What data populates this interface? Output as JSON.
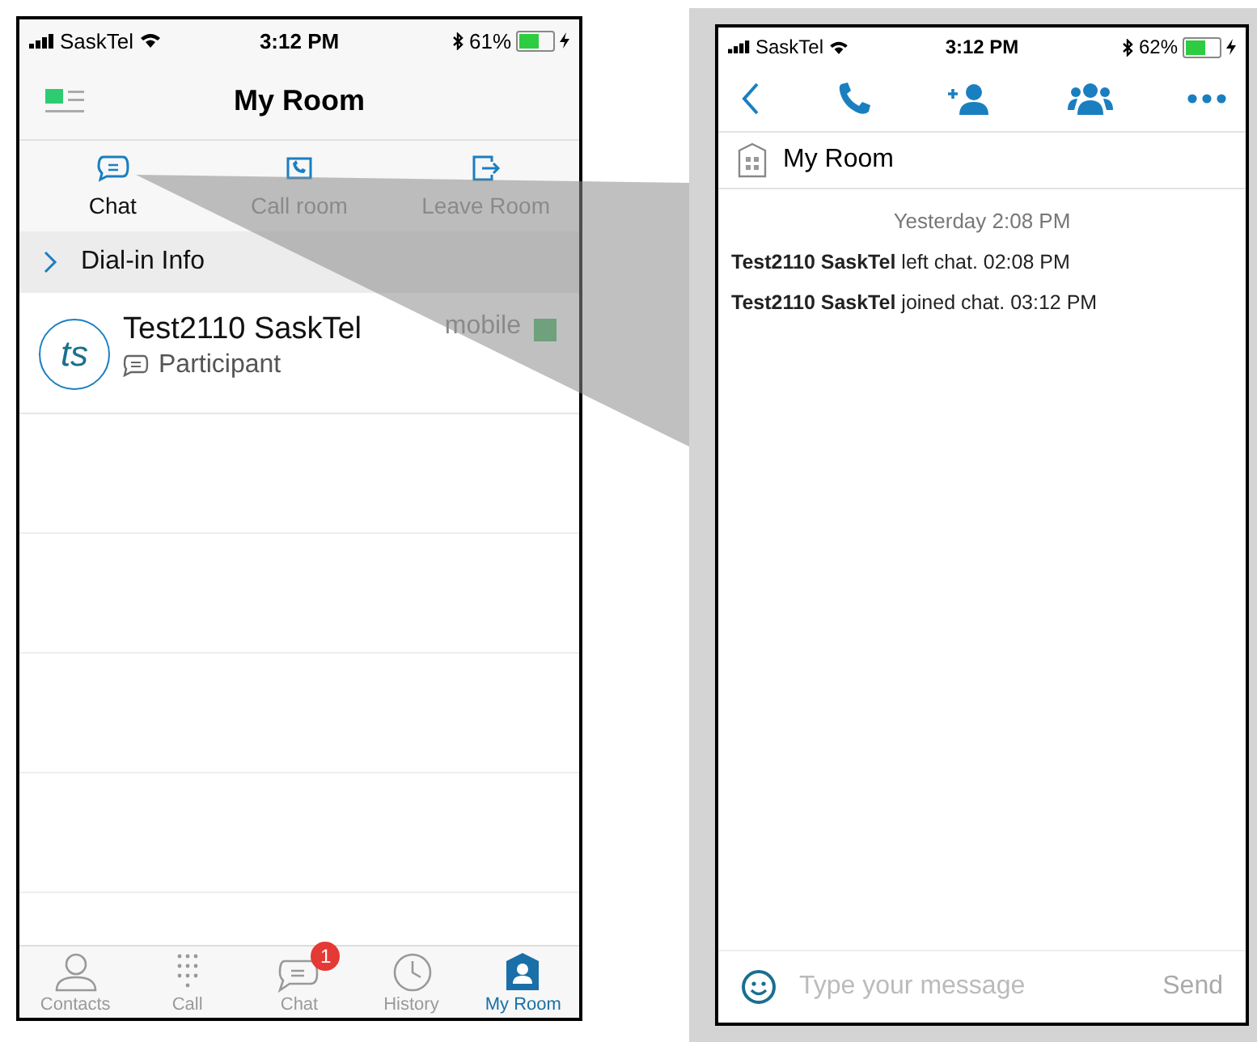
{
  "left_phone": {
    "status_bar": {
      "carrier": "SaskTel",
      "time": "3:12 PM",
      "battery": "61%"
    },
    "header": {
      "title": "My Room"
    },
    "actions": [
      {
        "kind": "chat",
        "label": "Chat",
        "selected": true
      },
      {
        "kind": "call",
        "label": "Call room",
        "selected": false
      },
      {
        "kind": "leave",
        "label": "Leave Room",
        "selected": false
      }
    ],
    "dial_in": {
      "label": "Dial-in Info",
      "expanded": false
    },
    "participants": [
      {
        "initials": "ts",
        "name": "Test2110 SaskTel",
        "role": "Participant",
        "device": "mobile"
      }
    ],
    "tab_bar": [
      {
        "kind": "contacts",
        "label": "Contacts",
        "selected": false
      },
      {
        "kind": "dialpad",
        "label": "Call",
        "selected": false
      },
      {
        "kind": "chat",
        "label": "Chat",
        "selected": false,
        "badge": "1"
      },
      {
        "kind": "history",
        "label": "History",
        "selected": false
      },
      {
        "kind": "room",
        "label": "My Room",
        "selected": true
      }
    ]
  },
  "right_phone": {
    "status_bar": {
      "carrier": "SaskTel",
      "time": "3:12 PM",
      "battery": "62%"
    },
    "room": {
      "title": "My Room"
    },
    "date": "Yesterday 2:08 PM",
    "events": [
      {
        "name": "Test2110 SaskTel",
        "text": "left chat. 02:08 PM"
      },
      {
        "name": "Test2110 SaskTel",
        "text": "joined chat. 03:12 PM"
      }
    ],
    "composer": {
      "placeholder": "Type your message",
      "send": "Send"
    }
  }
}
